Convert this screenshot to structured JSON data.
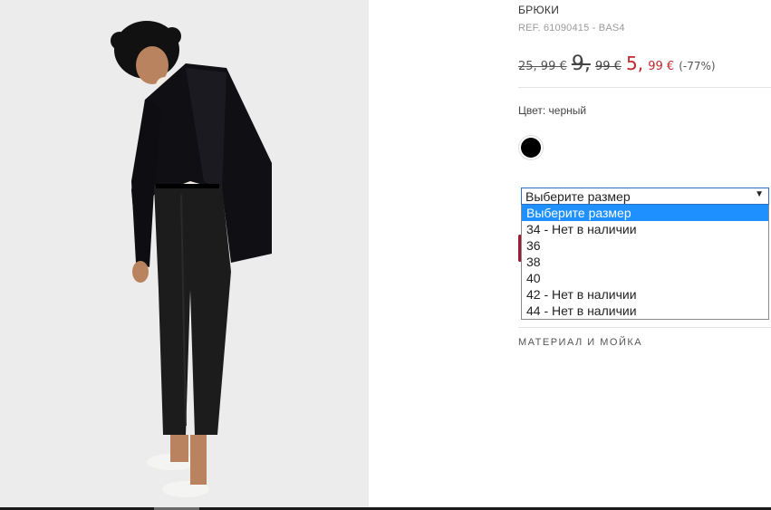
{
  "product": {
    "title": "БРЮКИ",
    "ref": "REF. 61090415 - BAS4"
  },
  "price": {
    "old_price_1": "25, 99 €",
    "old_price_2_int": "9,",
    "old_price_2_dec": "99 €",
    "new_price_int": "5,",
    "new_price_dec": "99 €",
    "discount": "(-77%)",
    "sale_color": "#c0282d"
  },
  "color": {
    "label": "Цвет: черный",
    "swatch_color": "#000000"
  },
  "size_select": {
    "value": "Выберите размер",
    "arrow": "▼",
    "options": [
      "Выберите размер",
      "34 - Нет в наличии",
      "36",
      "38",
      "40",
      "42 - Нет в наличии",
      "44 - Нет в наличии"
    ],
    "highlight_color": "#1e90ff"
  },
  "sections": {
    "material": "МАТЕРИАЛ И МОЙКА"
  },
  "image": {
    "icon": "product-photo-woman-in-black-suit"
  }
}
